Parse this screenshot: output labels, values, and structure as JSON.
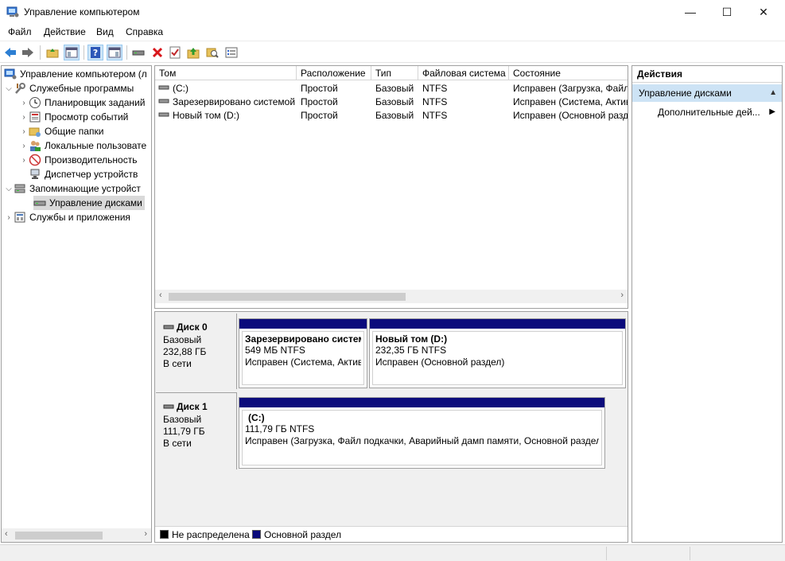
{
  "window": {
    "title": "Управление компьютером",
    "minimize_glyph": "—",
    "maximize_glyph": "☐",
    "close_glyph": "✕"
  },
  "menu": [
    "Файл",
    "Действие",
    "Вид",
    "Справка"
  ],
  "toolbar": {
    "icons": [
      "back-arrow-icon",
      "forward-arrow-icon",
      "up-folder-icon",
      "show-hide-tree-icon",
      "help-icon",
      "show-hide-action-icon",
      "connect-drive-icon",
      "delete-icon",
      "properties-icon",
      "folder-up-icon",
      "search-folder-icon",
      "list-view-icon"
    ]
  },
  "tree": {
    "root": "Управление компьютером (л",
    "items": [
      {
        "label": "Служебные программы",
        "level": 1,
        "expanded": true,
        "icon": "tools-icon"
      },
      {
        "label": "Планировщик заданий",
        "level": 2,
        "icon": "clock-icon"
      },
      {
        "label": "Просмотр событий",
        "level": 2,
        "icon": "event-viewer-icon"
      },
      {
        "label": "Общие папки",
        "level": 2,
        "icon": "shared-folder-icon"
      },
      {
        "label": "Локальные пользовате",
        "level": 2,
        "icon": "users-icon"
      },
      {
        "label": "Производительность",
        "level": 2,
        "icon": "performance-icon"
      },
      {
        "label": "Диспетчер устройств",
        "level": 2,
        "icon": "device-manager-icon"
      },
      {
        "label": "Запоминающие устройст",
        "level": 1,
        "expanded": true,
        "icon": "storage-icon"
      },
      {
        "label": "Управление дисками",
        "level": 2,
        "selected": true,
        "icon": "disk-management-icon"
      },
      {
        "label": "Службы и приложения",
        "level": 1,
        "expanded": false,
        "icon": "services-icon"
      }
    ]
  },
  "volumes": {
    "columns": [
      "Том",
      "Расположение",
      "Тип",
      "Файловая система",
      "Состояние"
    ],
    "rows": [
      [
        "(C:)",
        "Простой",
        "Базовый",
        "NTFS",
        "Исправен (Загрузка, Файл"
      ],
      [
        "Зарезервировано системой",
        "Простой",
        "Базовый",
        "NTFS",
        "Исправен (Система, Активе"
      ],
      [
        "Новый том (D:)",
        "Простой",
        "Базовый",
        "NTFS",
        "Исправен (Основной разд"
      ]
    ]
  },
  "disks": [
    {
      "name": "Диск 0",
      "type": "Базовый",
      "size": "232,88 ГБ",
      "status": "В сети",
      "partitions": [
        {
          "title": "Зарезервировано систем",
          "size": "549 МБ NTFS",
          "status": "Исправен (Система, Актив"
        },
        {
          "title": "Новый том  (D:)",
          "size": "232,35 ГБ NTFS",
          "status": "Исправен (Основной раздел)"
        }
      ]
    },
    {
      "name": "Диск 1",
      "type": "Базовый",
      "size": "111,79 ГБ",
      "status": "В сети",
      "partitions": [
        {
          "title": "(C:)",
          "size": "111,79 ГБ NTFS",
          "status": "Исправен (Загрузка, Файл подкачки, Аварийный дамп памяти, Основной раздел"
        }
      ]
    }
  ],
  "legend": [
    {
      "label": "Не распределена",
      "color": "#000000"
    },
    {
      "label": "Основной раздел",
      "color": "#0b0b7c"
    }
  ],
  "actions": {
    "header": "Действия",
    "section": "Управление дисками",
    "item": "Дополнительные дей..."
  },
  "colors": {
    "partition_bar": "#0b0b7c",
    "selection": "#cde3f5"
  }
}
